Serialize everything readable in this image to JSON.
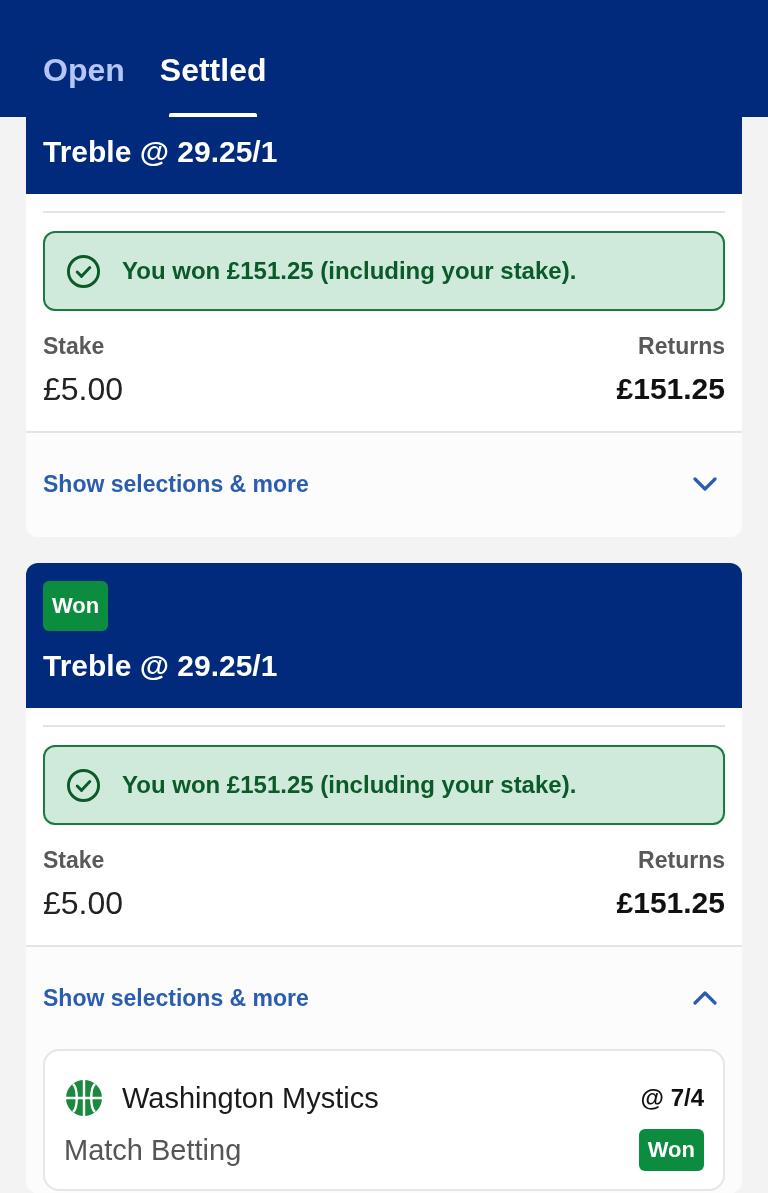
{
  "tabs": [
    {
      "label": "Open",
      "selected": false
    },
    {
      "label": "Settled",
      "selected": true
    }
  ],
  "bets": [
    {
      "title": "Treble @ 29.25/1",
      "result_message": "You won £151.25 (including your stake).",
      "stake_label": "Stake",
      "stake": "£5.00",
      "returns_label": "Returns",
      "returns": "£151.25",
      "toggle_label": "Show selections & more",
      "expanded": false
    },
    {
      "badge": "Won",
      "title": "Treble @ 29.25/1",
      "result_message": "You won £151.25 (including your stake).",
      "stake_label": "Stake",
      "stake": "£5.00",
      "returns_label": "Returns",
      "returns": "£151.25",
      "toggle_label": "Show selections & more",
      "expanded": true,
      "selections": [
        {
          "name": "Washington Mystics",
          "odds": "@ 7/4",
          "market": "Match Betting",
          "result": "Won"
        }
      ]
    }
  ]
}
